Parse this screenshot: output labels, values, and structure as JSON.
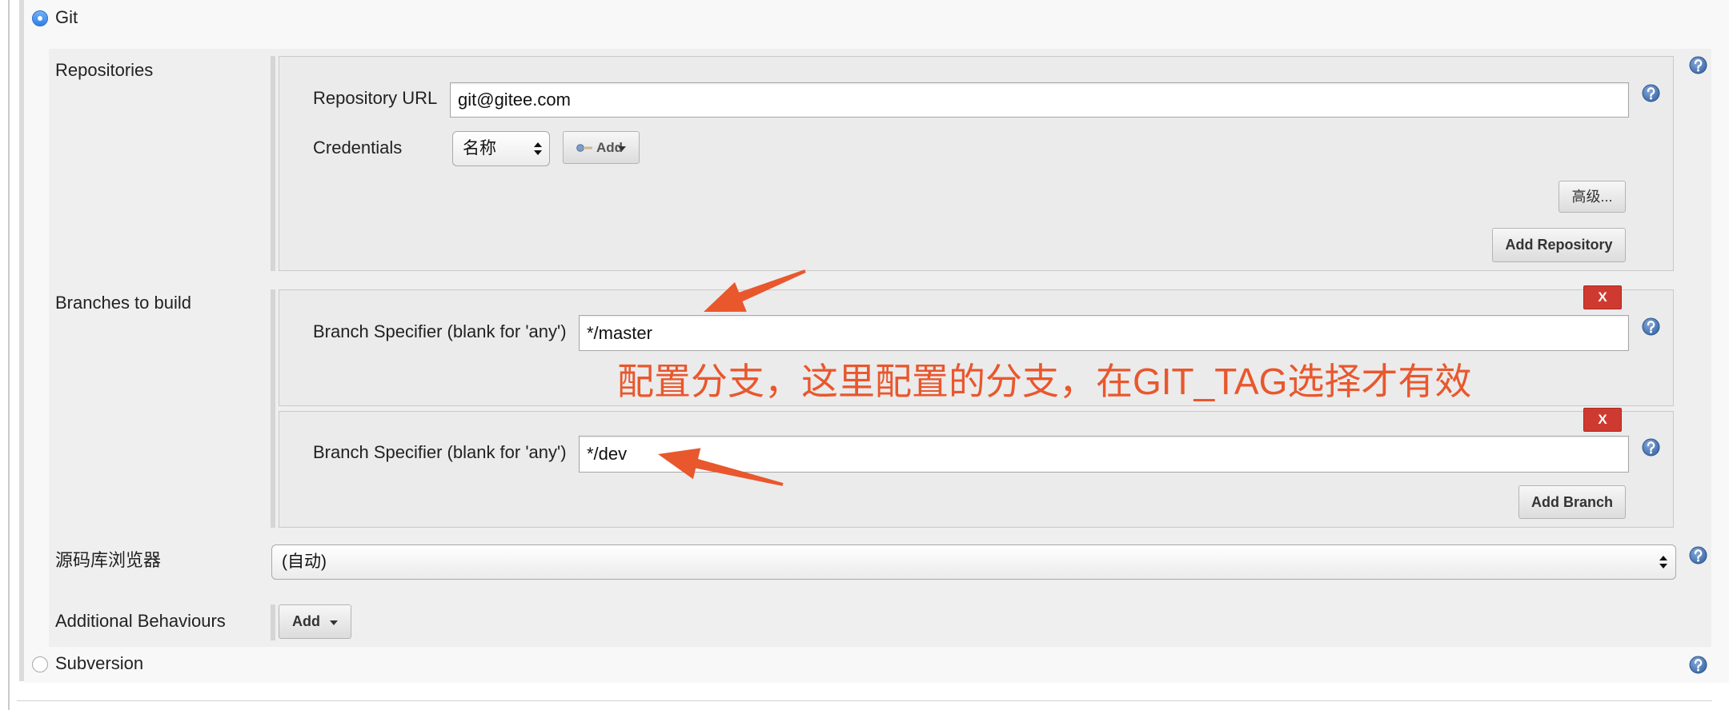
{
  "scm": {
    "git": {
      "label": "Git",
      "selected": true
    },
    "subversion": {
      "label": "Subversion",
      "selected": false
    }
  },
  "repositories": {
    "label": "Repositories",
    "url_label": "Repository URL",
    "url_value": "git@gitee.com",
    "credentials_label": "Credentials",
    "credentials_selected": "名称",
    "credentials_add_label": "Add",
    "advanced_label": "高级...",
    "add_repository_label": "Add Repository"
  },
  "branches": {
    "label": "Branches to build",
    "items": [
      {
        "specifier_label": "Branch Specifier (blank for 'any')",
        "value": "*/master",
        "delete_label": "X"
      },
      {
        "specifier_label": "Branch Specifier (blank for 'any')",
        "value": "*/dev",
        "delete_label": "X"
      }
    ],
    "add_branch_label": "Add Branch"
  },
  "repository_browser": {
    "label": "源码库浏览器",
    "selected": "(自动)"
  },
  "additional_behaviours": {
    "label": "Additional Behaviours",
    "add_label": "Add"
  },
  "annotation": {
    "text": "配置分支，这里配置的分支，在GIT_TAG选择才有效"
  },
  "icons": {
    "help": "help-icon",
    "key": "key-icon",
    "select_arrows": "select-arrows-icon",
    "dropdown": "chevron-down-icon",
    "annotation_arrow": "annotation-arrow"
  },
  "colors": {
    "accent": "#2f80e6",
    "danger": "#cf3a30",
    "annotation": "#e9572d",
    "help": "#3f6fae"
  }
}
